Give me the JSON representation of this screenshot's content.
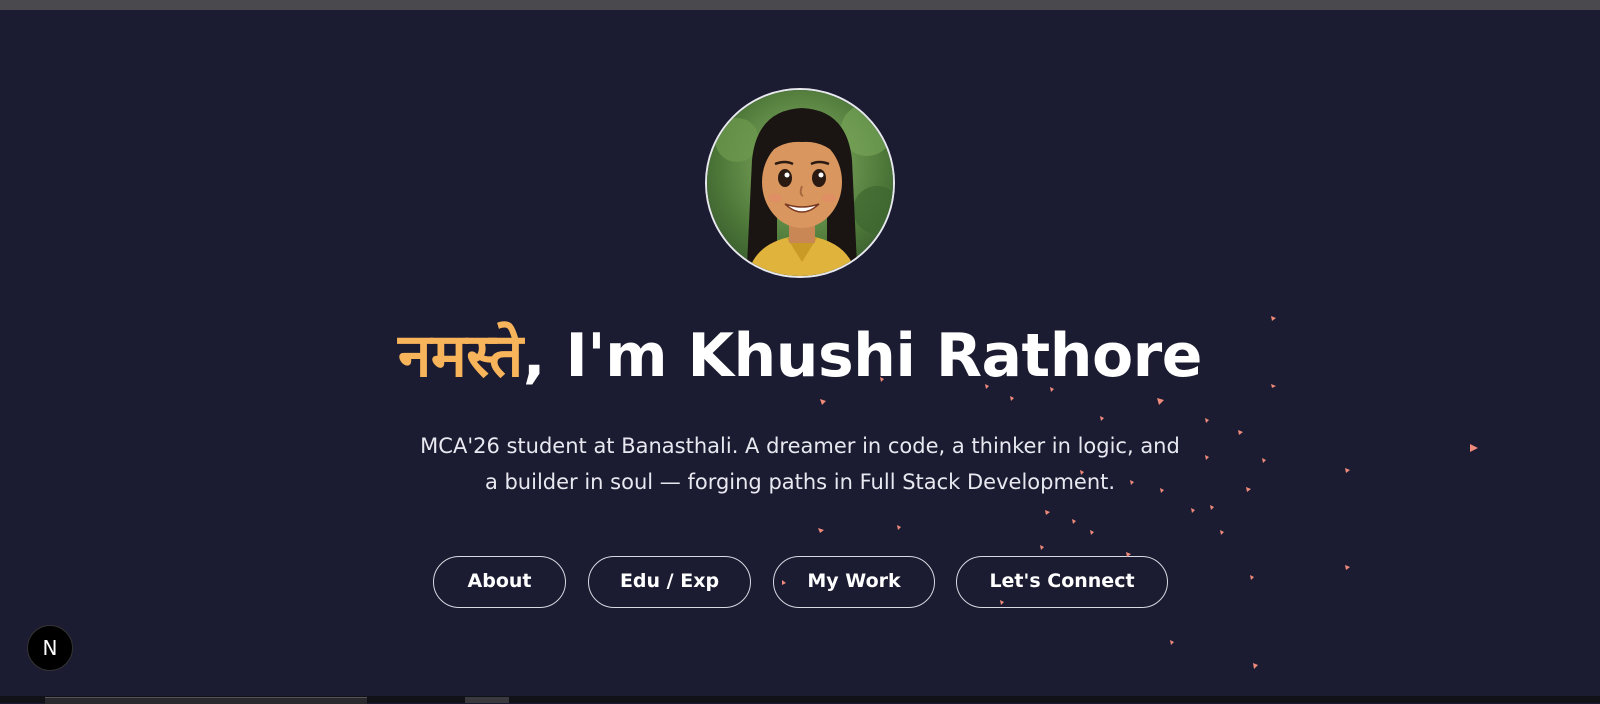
{
  "hero": {
    "greeting": "नमस्ते",
    "intro": ", I'm Khushi Rathore",
    "bio_line1": "MCA'26 student at Banasthali. A dreamer in code, a thinker in logic, and",
    "bio_line2": "a builder in soul — forging paths in Full Stack Development."
  },
  "nav": {
    "about": "About",
    "edu_exp": "Edu / Exp",
    "my_work": "My Work",
    "connect": "Let's Connect"
  },
  "fab": {
    "label": "N"
  },
  "colors": {
    "background": "#1b1b31",
    "accent": "#f8b45a",
    "text": "#ffffff",
    "particle": "#f08a7a"
  }
}
